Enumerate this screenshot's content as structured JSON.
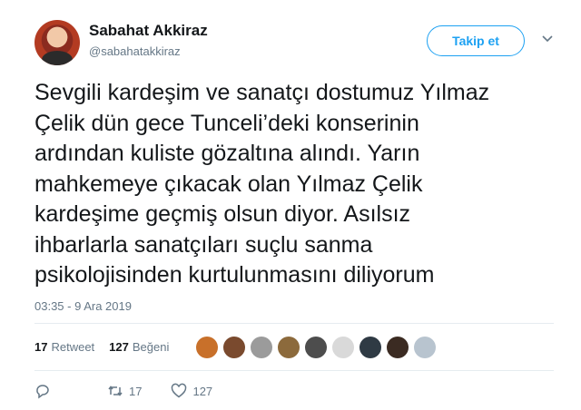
{
  "author": {
    "display_name": "Sabahat Akkiraz",
    "handle": "@sabahatakkiraz"
  },
  "follow_button_label": "Takip et",
  "tweet_text_lines": [
    "Sevgili kardeşim ve sanatçı dostumuz Yılmaz",
    "Çelik dün gece Tunceli’deki konserinin",
    "ardından kuliste gözaltına alındı. Yarın",
    "mahkemeye çıkacak olan Yılmaz Çelik",
    "kardeşime geçmiş olsun diyor. Asılsız",
    "ihbarlarla sanatçıları suçlu sanma",
    "psikolojisinden kurtulunmasını diliyorum"
  ],
  "timestamp": "03:35 - 9 Ara 2019",
  "stats": {
    "retweet_count": "17",
    "retweet_label": "Retweet",
    "like_count": "127",
    "like_label": "Beğeni"
  },
  "liker_avatars": [
    {
      "color": "#c8702a"
    },
    {
      "color": "#7a4a2e"
    },
    {
      "color": "#9b9b9b"
    },
    {
      "color": "#8c6a3c"
    },
    {
      "color": "#4d4d4d"
    },
    {
      "color": "#d9d9d9"
    },
    {
      "color": "#2f3a44"
    },
    {
      "color": "#3b2b22"
    },
    {
      "color": "#b8c4cf"
    }
  ],
  "actions": {
    "reply_icon": "reply-icon",
    "retweet_icon": "retweet-icon",
    "retweet_count": "17",
    "like_icon": "heart-icon",
    "like_count": "127"
  },
  "colors": {
    "accent": "#1da1f2",
    "secondary_text": "#657786",
    "divider": "#e6ecf0"
  }
}
